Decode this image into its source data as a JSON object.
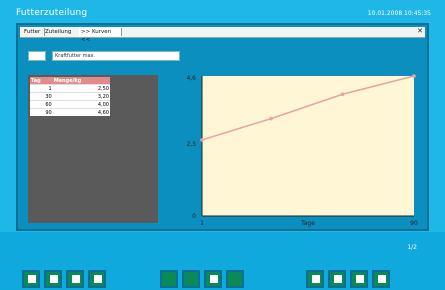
{
  "app": {
    "title": "Futterzuteilung",
    "datetime": "10.01.2008 10:45:35"
  },
  "tabs": [
    {
      "label": "Futter"
    },
    {
      "label": "Zuteilung"
    },
    {
      "label": ">> Kurven <<",
      "active": true
    }
  ],
  "form": {
    "field_value": "Kraftfutter max."
  },
  "table": {
    "headers": [
      "Tag",
      "Menge/kg"
    ],
    "rows": [
      [
        "1",
        "2,50"
      ],
      [
        "30",
        "3,20"
      ],
      [
        "60",
        "4,00"
      ],
      [
        "90",
        "4,60"
      ]
    ]
  },
  "chart_data": {
    "type": "line",
    "x": [
      1,
      30,
      60,
      90
    ],
    "y": [
      2.5,
      3.2,
      4.0,
      4.6
    ],
    "xlabel": "Tage",
    "ylabel": "",
    "xlim": [
      1,
      90
    ],
    "ylim": [
      0,
      4.6
    ],
    "y_tick_labels": [
      "0",
      "2,3",
      "4,6"
    ],
    "x_tick_labels": [
      "1",
      "90"
    ],
    "grid": false,
    "colors": {
      "background": "#fff6d6",
      "line": "#e6a3a3",
      "axis": "#222222"
    }
  },
  "footer": {
    "page_label": "1/2"
  },
  "toolbar": {
    "groups": [
      {
        "name": "toolbar-group-1",
        "items": [
          "info-icon",
          "list-icon",
          "minus-icon",
          "square-icon"
        ]
      },
      {
        "name": "toolbar-group-2",
        "items": [
          "blank-icon",
          "blank-icon",
          "image-icon",
          "blank-icon"
        ]
      },
      {
        "name": "toolbar-group-3",
        "items": [
          "stop-icon",
          "square-icon",
          "copy-icon",
          "check-icon"
        ]
      }
    ]
  }
}
